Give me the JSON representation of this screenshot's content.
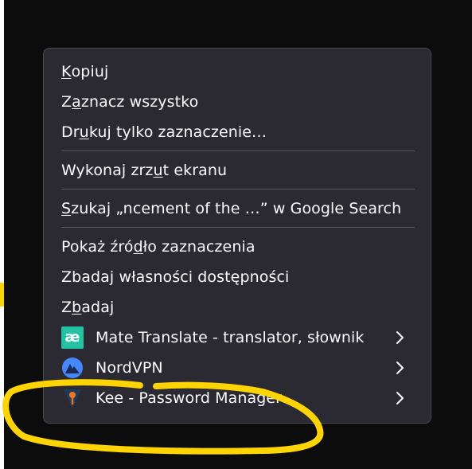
{
  "menu": {
    "items": [
      {
        "before": "",
        "u": "K",
        "after": "opiuj"
      },
      {
        "before": "Z",
        "u": "a",
        "after": "znacz wszystko"
      },
      {
        "before": "Dr",
        "u": "u",
        "after": "kuj tylko zaznaczenie…"
      },
      {
        "before": "Wykonaj zrz",
        "u": "u",
        "after": "t ekranu"
      },
      {
        "before": "",
        "u": "S",
        "after": "zukaj „ncement of the …” w Google Search"
      },
      {
        "before": "Pokaż źró",
        "u": "d",
        "after": "ło zaznaczenia"
      },
      {
        "before": "Zbadaj własności dostępności",
        "u": "",
        "after": ""
      },
      {
        "before": "Z",
        "u": "b",
        "after": "adaj"
      }
    ],
    "extensions": [
      {
        "label": "Mate Translate - translator, słownik",
        "icon": "mate-translate-icon",
        "icon_text": "æ",
        "has_submenu": true
      },
      {
        "label": "NordVPN",
        "icon": "nordvpn-icon",
        "has_submenu": true
      },
      {
        "label": "Kee - Password Manager",
        "icon": "kee-icon",
        "has_submenu": true
      }
    ]
  },
  "colors": {
    "background": "#0c0c0d",
    "menu_bg": "#2b2a33",
    "menu_border": "#4a4950",
    "text": "#fbfbfe",
    "separator": "#5a5960",
    "mate_green": "#23c3a2",
    "nord_blue": "#4687ff",
    "kee_orange": "#f2761c",
    "highlight_yellow": "#ffd400"
  }
}
